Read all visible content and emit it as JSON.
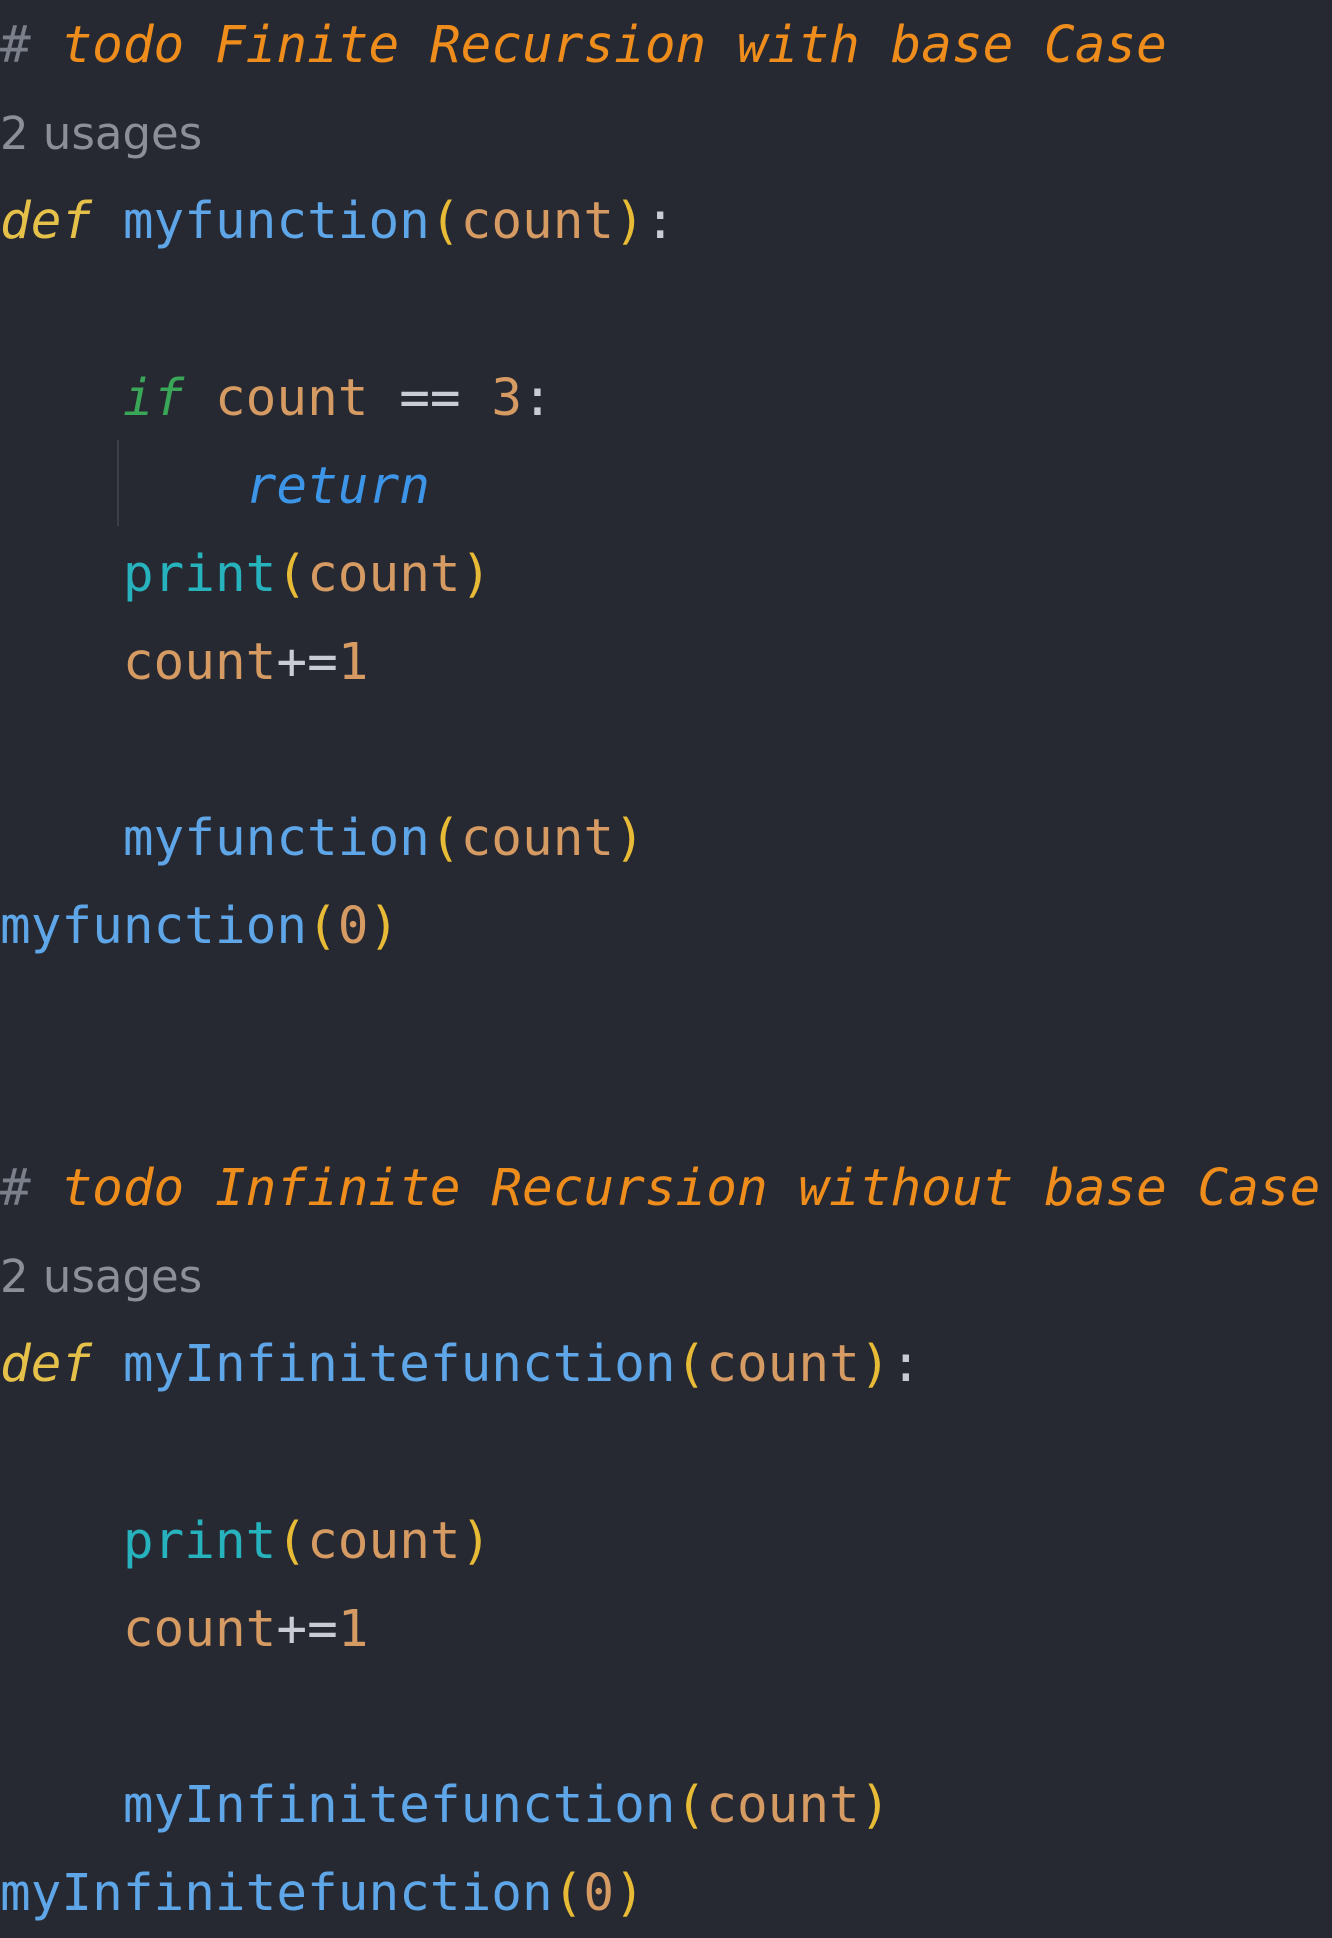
{
  "editor": {
    "language": "python",
    "colors": {
      "background": "#262932",
      "comment_hash": "#7b7f8a",
      "todo_comment": "#ee8d1c",
      "keyword_def": "#e6c14a",
      "function_name": "#5ea6e8",
      "paren": "#e8bb36",
      "parameter": "#d69a63",
      "operator": "#c9ccd4",
      "number": "#d69a63",
      "keyword_if": "#3aa657",
      "keyword_return": "#3d95e8",
      "builtin": "#26b3bd",
      "usage_hint": "#8c8f98"
    },
    "block1": {
      "comment_hash": "#",
      "comment_text": "todo Finite Recursion with base Case",
      "usages_hint": "2 usages",
      "def_kw": "def",
      "func_name": "myfunction",
      "open_paren": "(",
      "param": "count",
      "close_paren": ")",
      "colon": ":",
      "if_kw": "if",
      "if_var": "count",
      "if_op": "==",
      "if_num": "3",
      "if_colon": ":",
      "return_kw": "return",
      "print_fn": "print",
      "print_open": "(",
      "print_arg": "count",
      "print_close": ")",
      "incr_var": "count",
      "incr_op": "+=",
      "incr_num": "1",
      "call_name": "myfunction",
      "call_open": "(",
      "call_arg": "count",
      "call_close": ")",
      "top_call_name": "myfunction",
      "top_call_open": "(",
      "top_call_arg": "0",
      "top_call_close": ")"
    },
    "block2": {
      "comment_hash": "#",
      "comment_text": "todo Infinite Recursion without base Case",
      "usages_hint": "2 usages",
      "def_kw": "def",
      "func_name": "myInfinitefunction",
      "open_paren": "(",
      "param": "count",
      "close_paren": ")",
      "colon": ":",
      "print_fn": "print",
      "print_open": "(",
      "print_arg": "count",
      "print_close": ")",
      "incr_var": "count",
      "incr_op": "+=",
      "incr_num": "1",
      "call_name": "myInfinitefunction",
      "call_open": "(",
      "call_arg": "count",
      "call_close": ")",
      "top_call_name": "myInfinitefunction",
      "top_call_open": "(",
      "top_call_arg": "0",
      "top_call_close": ")"
    }
  }
}
